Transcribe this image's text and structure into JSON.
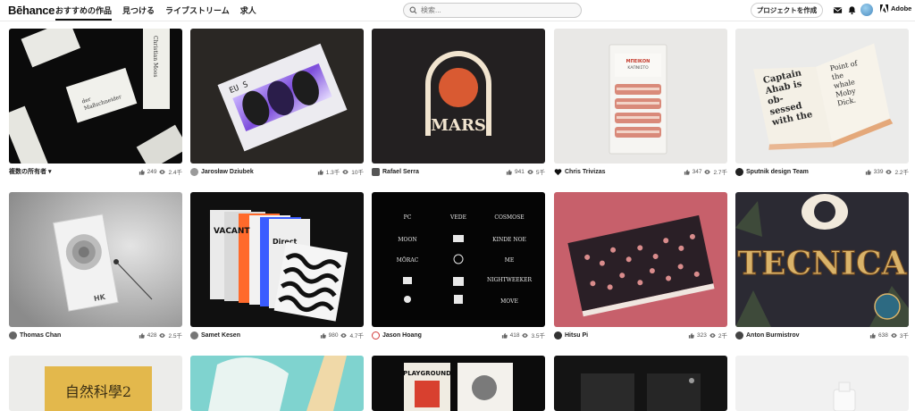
{
  "header": {
    "logo": "Bēhance",
    "nav": [
      {
        "label": "おすすめの作品",
        "active": true
      },
      {
        "label": "見つける",
        "active": false
      },
      {
        "label": "ライブストリーム",
        "active": false
      },
      {
        "label": "求人",
        "active": false
      }
    ],
    "search_placeholder": "検索...",
    "create_label": "プロジェクトを作成",
    "brand": "Adobe"
  },
  "projects": [
    {
      "owner": "複数の所有者 ▾",
      "likes": "249",
      "views": "2.4千",
      "av": "#888888",
      "icon": "none"
    },
    {
      "owner": "Jarosław Dziubek",
      "likes": "1.3千",
      "views": "10千",
      "av": "#9a9a9a",
      "icon": "avatar"
    },
    {
      "owner": "Rafael Serra",
      "likes": "941",
      "views": "5千",
      "av": "#555555",
      "icon": "badge"
    },
    {
      "owner": "Chris Trivizas",
      "likes": "347",
      "views": "2.7千",
      "av": "#111111",
      "icon": "heart"
    },
    {
      "owner": "Sputnik design Team",
      "likes": "339",
      "views": "2.2千",
      "av": "#222222",
      "icon": "avatar"
    },
    {
      "owner": "Thomas Chan",
      "likes": "428",
      "views": "2.5千",
      "av": "#666666",
      "icon": "avatar"
    },
    {
      "owner": "Samet Kesen",
      "likes": "980",
      "views": "4.7千",
      "av": "#777777",
      "icon": "avatar"
    },
    {
      "owner": "Jason Hoang",
      "likes": "418",
      "views": "3.5千",
      "av": "#d23b3b",
      "icon": "avatar"
    },
    {
      "owner": "Hitsu Pi",
      "likes": "323",
      "views": "2千",
      "av": "#333333",
      "icon": "avatar"
    },
    {
      "owner": "Anton Burmistrov",
      "likes": "638",
      "views": "3千",
      "av": "#444444",
      "icon": "avatar"
    }
  ],
  "artwork_text": {
    "mars": "MARS",
    "captain": [
      "Captain",
      "Ahab is",
      "ob-",
      "sessed",
      "with the"
    ],
    "captain_right": [
      "Point of",
      "the",
      "whale",
      "Moby",
      "Dick."
    ],
    "tecnica": "TECNICA",
    "hk": "HK",
    "bacon_label": "ΜΠΕΙΚΟΝ",
    "bacon_sub": "ΚΑΠΝΙΣΤΟ",
    "kanji": "自然科學2",
    "playground": "PLAYGROUND",
    "vacant": "VACANT",
    "direct": "Direct",
    "logo_grid": [
      "PC",
      "VEDE",
      "COSMOSE",
      "MOON",
      "",
      "KINDE NOE",
      "MŌRAC",
      "",
      "ME",
      "",
      "",
      "NIGHTWEEKER",
      "",
      "",
      "MOVE"
    ],
    "eus": "EU S"
  }
}
